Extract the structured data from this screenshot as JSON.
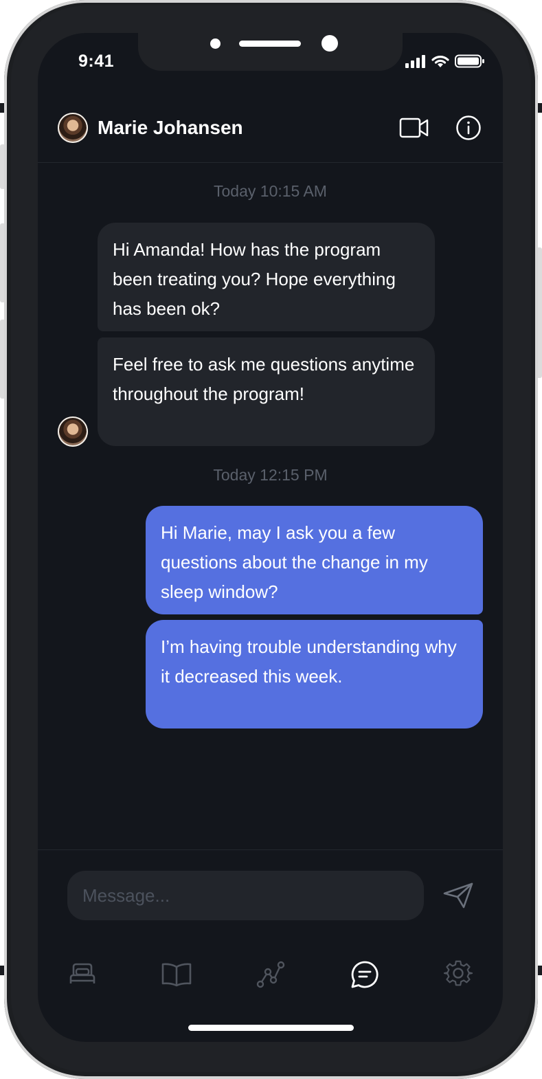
{
  "status_bar": {
    "time": "9:41"
  },
  "header": {
    "contact_name": "Marie Johansen",
    "video_icon": "video-camera-icon",
    "info_icon": "info-icon"
  },
  "messages": [
    {
      "timestamp": "Today 10:15 AM"
    },
    {
      "sender": "Marie Johansen",
      "direction": "incoming",
      "text": "Hi Amanda! How has the program been treating you? Hope everything has been ok?"
    },
    {
      "sender": "Marie Johansen",
      "direction": "incoming",
      "text": "Feel free to ask me questions anytime throughout the program!"
    },
    {
      "timestamp": "Today 12:15 PM"
    },
    {
      "sender": "Amanda",
      "direction": "outgoing",
      "text": "Hi Marie, may I ask you a few questions about the change in my sleep window?"
    },
    {
      "sender": "Amanda",
      "direction": "outgoing",
      "text": "I’m having trouble understanding why it decreased this week."
    }
  ],
  "composer": {
    "placeholder": "Message...",
    "send_icon": "paper-plane-icon"
  },
  "tabbar": {
    "items": [
      {
        "icon": "bed-icon",
        "active": false
      },
      {
        "icon": "book-icon",
        "active": false
      },
      {
        "icon": "graph-icon",
        "active": false
      },
      {
        "icon": "chat-icon",
        "active": true
      },
      {
        "icon": "gear-icon",
        "active": false
      }
    ]
  },
  "colors": {
    "screen_background": "#13161c",
    "incoming_bubble": "#22252b",
    "outgoing_bubble": "#5570e0",
    "timestamp_text": "#5a606b",
    "inactive_icon": "#50555e",
    "active_icon": "#ffffff"
  }
}
